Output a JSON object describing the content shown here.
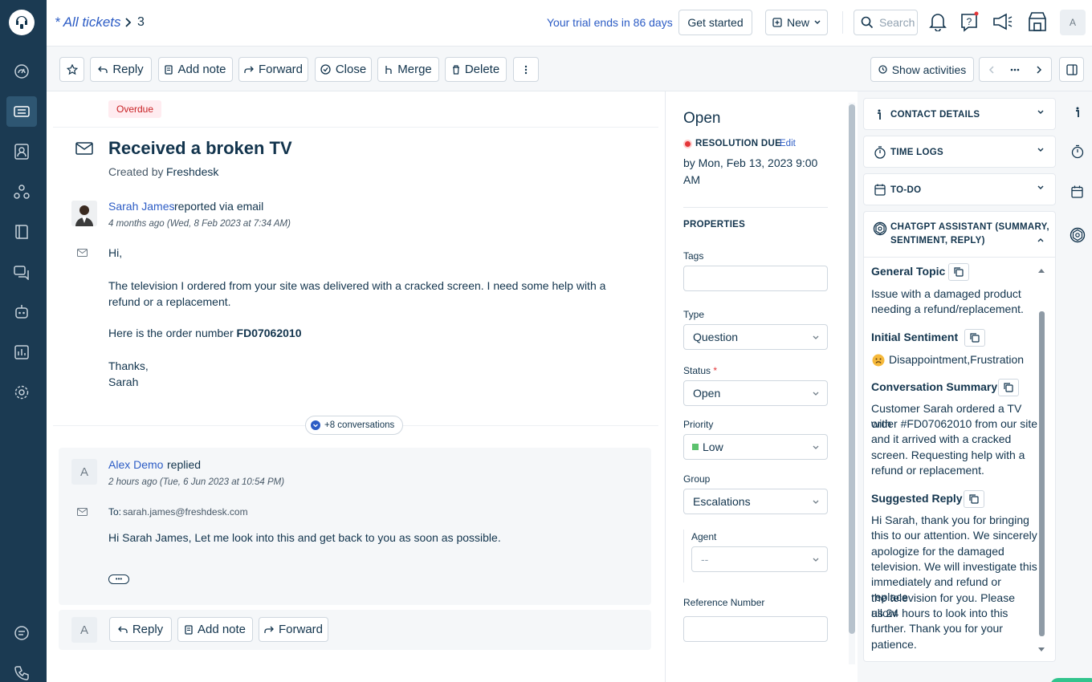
{
  "header": {
    "breadcrumb": "* All tickets",
    "ticket_number": "3",
    "trial_text": "Your trial ends in 86 days",
    "get_started": "Get started",
    "new_label": "New",
    "search_placeholder": "Search",
    "avatar": "A"
  },
  "toolbar": {
    "reply": "Reply",
    "add_note": "Add note",
    "forward": "Forward",
    "close": "Close",
    "merge": "Merge",
    "delete": "Delete",
    "show_activities": "Show activities"
  },
  "ticket": {
    "badge": "Overdue",
    "subject": "Received a broken TV",
    "created_by_label": "Created by",
    "created_by": "Freshdesk",
    "first_message": {
      "author": "Sarah James",
      "action": "reported via email",
      "time": "4 months ago (Wed, 8 Feb 2023 at 7:34 AM)",
      "greeting": "Hi,",
      "body1": "The television I ordered from your site was delivered with a cracked screen. I need some help with a refund or a replacement.",
      "body2_prefix": "Here is the order number",
      "order_number": "FD07062010",
      "sign1": "Thanks,",
      "sign2": "Sarah"
    },
    "conversations_pill": "+8 conversations",
    "reply_message": {
      "avatar": "A",
      "author": "Alex Demo",
      "action": "replied",
      "time": "2 hours ago (Tue, 6 Jun 2023 at 10:54 PM)",
      "to_label": "To:",
      "to": "sarah.james@freshdesk.com",
      "body": "Hi Sarah James, Let me look into this and get back to you as soon as possible.",
      "more": "•••"
    },
    "bottom_actions": {
      "avatar": "A",
      "reply": "Reply",
      "add_note": "Add note",
      "forward": "Forward"
    }
  },
  "properties": {
    "status_heading": "Open",
    "resolution_label": "RESOLUTION DUE",
    "edit_label": "Edit",
    "resolution_date_line1": "by Mon, Feb 13, 2023 9:00",
    "resolution_date_line2": "AM",
    "section_title": "PROPERTIES",
    "tags_label": "Tags",
    "type_label": "Type",
    "type_value": "Question",
    "status_label": "Status",
    "required_mark": "*",
    "status_value": "Open",
    "priority_label": "Priority",
    "priority_value": "Low",
    "priority_color": "#5cc26e",
    "group_label": "Group",
    "group_value": "Escalations",
    "agent_label": "Agent",
    "agent_value": "--",
    "reference_label": "Reference Number"
  },
  "right_panel": {
    "contact_details": "CONTACT DETAILS",
    "time_logs": "TIME LOGS",
    "todo": "TO-DO",
    "chatgpt_title_line1": "CHATGPT ASSISTANT (SUMMARY,",
    "chatgpt_title_line2": "SENTIMENT, REPLY)",
    "general_topic_label": "General Topic",
    "general_topic_line1": "Issue with a damaged product",
    "general_topic_line2": "needing a refund/replacement.",
    "initial_sentiment_label": "Initial Sentiment",
    "sentiment_value": "Disappointment,Frustration",
    "conversation_summary_label": "Conversation Summary",
    "conversation_summary": [
      "Customer Sarah ordered a TV with",
      "order #FD07062010 from our site",
      "and it arrived with a cracked",
      "screen. Requesting help with a",
      "refund or replacement."
    ],
    "suggested_reply_label": "Suggested Reply",
    "suggested_reply": [
      "Hi Sarah, thank you for bringing",
      "this to our attention. We sincerely",
      "apologize for the damaged",
      "television. We will investigate this",
      "immediately and refund or replace",
      "the television for you. Please allow",
      "us 24 hours to look into this",
      "further. Thank you for your",
      "patience."
    ]
  },
  "colors": {
    "nav_bg": "#1b3a52",
    "link": "#2c5cc5",
    "overdue_bg": "#ffecf0",
    "overdue_text": "#c82124",
    "due_dot": "#e43538"
  }
}
